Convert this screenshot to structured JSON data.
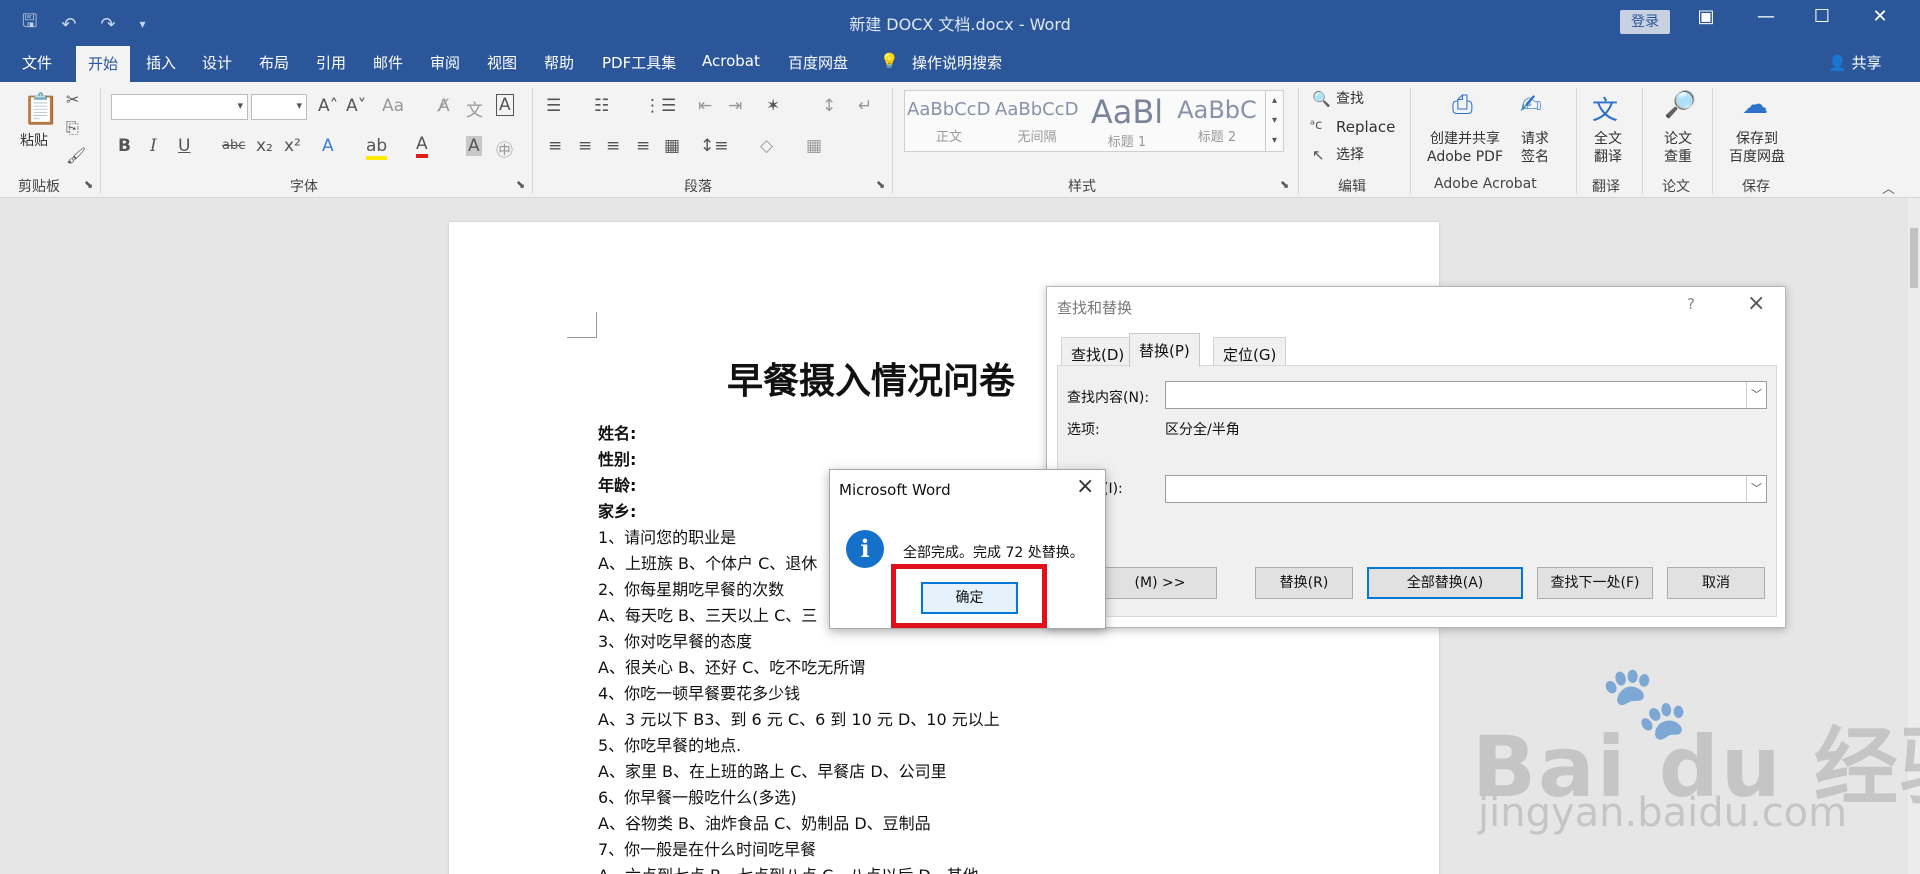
{
  "window": {
    "title": "新建 DOCX 文档.docx - Word",
    "login_label": "登录"
  },
  "menu": {
    "tabs": [
      "文件",
      "开始",
      "插入",
      "设计",
      "布局",
      "引用",
      "邮件",
      "审阅",
      "视图",
      "帮助",
      "PDF工具集",
      "Acrobat",
      "百度网盘"
    ],
    "active_tab": "开始",
    "tell_me": "操作说明搜索",
    "share": "共享"
  },
  "ribbon": {
    "clipboard": {
      "paste": "粘贴",
      "label": "剪贴板"
    },
    "font": {
      "label": "字体"
    },
    "paragraph": {
      "label": "段落"
    },
    "styles": {
      "label": "样式",
      "items": [
        {
          "sample": "AaBbCcDc",
          "name": "正文"
        },
        {
          "sample": "AaBbCcDc",
          "name": "无间隔"
        },
        {
          "sample": "AaBl",
          "name": "标题 1"
        },
        {
          "sample": "AaBbC",
          "name": "标题 2"
        }
      ]
    },
    "editing": {
      "find": "查找",
      "replace": "Replace",
      "select": "选择",
      "label": "编辑"
    },
    "adobe": {
      "create_share": "创建并共享",
      "adobe_pdf": "Adobe PDF",
      "request": "请求",
      "sign": "签名",
      "label": "Adobe Acrobat"
    },
    "translate": {
      "full": "全文",
      "translate": "翻译",
      "label": "翻译"
    },
    "paper": {
      "thesis": "论文",
      "check": "查重",
      "label": "论文"
    },
    "save": {
      "save_to": "保存到",
      "baidu": "百度网盘",
      "label": "保存"
    }
  },
  "document": {
    "title": "早餐摄入情况问卷",
    "fields": [
      "姓名:",
      "性别:",
      "年龄:",
      "家乡:"
    ],
    "lines": [
      "1、请问您的职业是",
      "A、上班族 B、个体户 C、退休",
      "2、你每星期吃早餐的次数",
      "A、每天吃 B、三天以上 C、三",
      "3、你对吃早餐的态度",
      "A、很关心 B、还好 C、吃不吃无所谓",
      "4、你吃一顿早餐要花多少钱",
      "A、3 元以下 B3、到 6 元 C、6 到 10 元 D、10 元以上",
      "5、你吃早餐的地点.",
      "A、家里 B、在上班的路上 C、早餐店 D、公司里",
      "6、你早餐一般吃什么(多选)",
      "A、谷物类 B、油炸食品 C、奶制品 D、豆制品",
      "7、你一般是在什么时间吃早餐",
      "A、六点到七点 B、七点到八点 C、八点以后 D、其他"
    ]
  },
  "find_replace": {
    "title": "查找和替换",
    "help": "?",
    "tabs": [
      "查找(D)",
      "替换(P)",
      "定位(G)"
    ],
    "active_tab": "替换(P)",
    "find_label": "查找内容(N):",
    "find_value": "",
    "options_label": "选项:",
    "options_value": "区分全/半角",
    "replace_label_partial": "(I):",
    "replace_value": "",
    "more_btn": "(M) >>",
    "replace_btn": "替换(R)",
    "replace_all_btn": "全部替换(A)",
    "find_next_btn": "查找下一处(F)",
    "cancel_btn": "取消"
  },
  "message": {
    "title": "Microsoft Word",
    "text": "全部完成。完成 72 处替换。",
    "ok": "确定"
  },
  "watermark": {
    "logo": "Bai du 经验",
    "url": "jingyan.baidu.com"
  },
  "colors": {
    "word_blue": "#2b579a",
    "highlight_red": "#e0111b",
    "focus_blue": "#0078d7"
  }
}
